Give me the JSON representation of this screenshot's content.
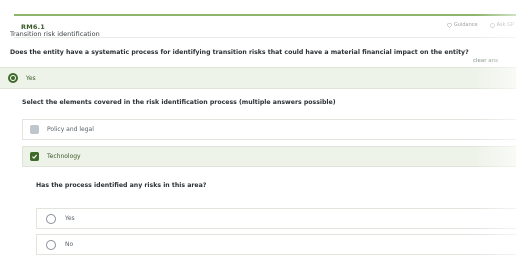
{
  "header": {
    "code": "RM6.1",
    "guidance_label": "Guidance",
    "ask_label": "Ask GP"
  },
  "section": {
    "title": "Transition risk identification"
  },
  "question": {
    "text": "Does the entity have a systematic process for identifying transition risks that could have a material financial impact on the entity?",
    "clear_label": "clear ans",
    "selected_answer": "Yes"
  },
  "elements": {
    "prompt": "Select the elements covered in the risk identification process (multiple answers possible)",
    "options": [
      {
        "label": "Policy and legal",
        "checked": false
      },
      {
        "label": "Technology",
        "checked": true
      }
    ]
  },
  "followup": {
    "prompt": "Has the process identified any risks in this area?",
    "options": [
      {
        "label": "Yes",
        "selected": false
      },
      {
        "label": "No",
        "selected": false
      }
    ]
  },
  "colors": {
    "accent": "#3f6b2a",
    "accent_border": "#8db66d",
    "selected_bg": "#eef3ea"
  }
}
